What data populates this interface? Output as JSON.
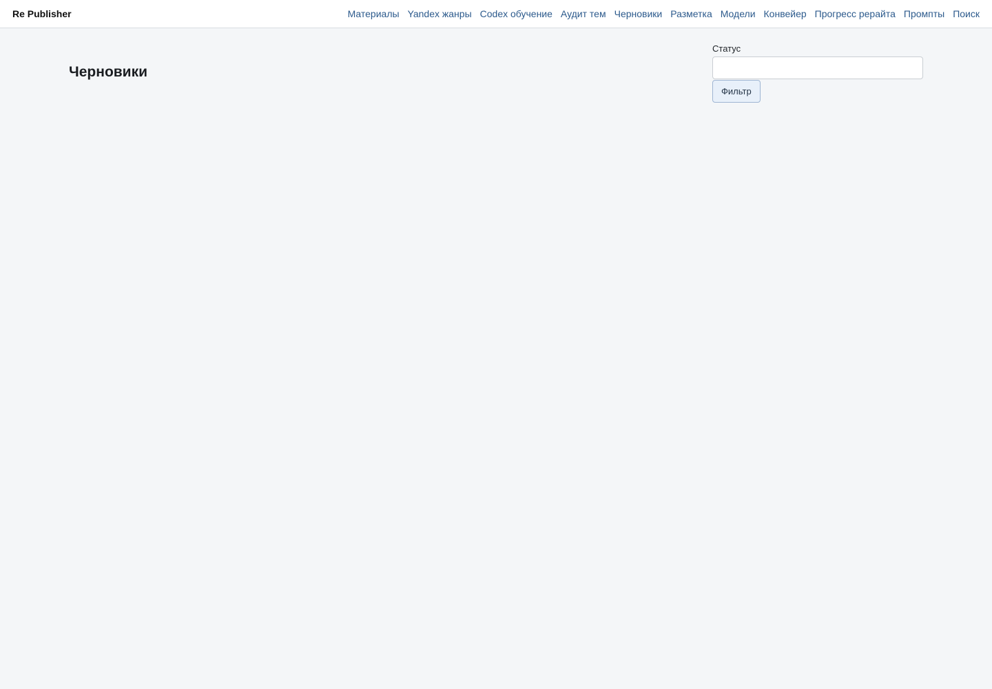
{
  "header": {
    "brand": "Re Publisher",
    "nav": [
      {
        "label": "Материалы"
      },
      {
        "label": "Yandex жанры"
      },
      {
        "label": "Codex обучение"
      },
      {
        "label": "Аудит тем"
      },
      {
        "label": "Черновики"
      },
      {
        "label": "Разметка"
      },
      {
        "label": "Модели"
      },
      {
        "label": "Конвейер"
      },
      {
        "label": "Прогресс рерайта"
      },
      {
        "label": "Промпты"
      },
      {
        "label": "Поиск"
      }
    ]
  },
  "main": {
    "title": "Черновики"
  },
  "filter": {
    "status_label": "Статус",
    "status_value": "",
    "submit_label": "Фильтр"
  },
  "colors": {
    "background": "#f4f6f8",
    "nav_link": "#2c5a8c",
    "button_bg": "#e8f0fa"
  }
}
